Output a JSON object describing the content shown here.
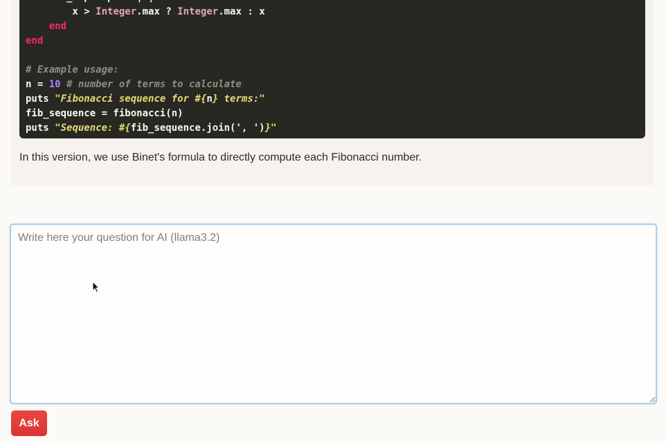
{
  "answer": {
    "code_lines": [
      [
        {
          "t": "    ",
          "c": "plain"
        },
        {
          "t": "fib_map",
          "c": "plain"
        },
        {
          "t": ".",
          "c": "plain"
        },
        {
          "t": "map",
          "c": "plain"
        },
        {
          "t": " do ",
          "c": "kw"
        },
        {
          "t": "|x|",
          "c": "plain"
        }
      ],
      [
        {
          "t": "        x > ",
          "c": "plain"
        },
        {
          "t": "Integer",
          "c": "cls"
        },
        {
          "t": ".max ? ",
          "c": "plain"
        },
        {
          "t": "Integer",
          "c": "cls"
        },
        {
          "t": ".max : x",
          "c": "plain"
        }
      ],
      [
        {
          "t": "    ",
          "c": "plain"
        },
        {
          "t": "end",
          "c": "kw"
        }
      ],
      [
        {
          "t": "end",
          "c": "kw"
        }
      ],
      [
        {
          "t": "",
          "c": "plain"
        }
      ],
      [
        {
          "t": "# Example usage:",
          "c": "cmt"
        }
      ],
      [
        {
          "t": "n = ",
          "c": "plain"
        },
        {
          "t": "10",
          "c": "num"
        },
        {
          "t": " ",
          "c": "plain"
        },
        {
          "t": "# number of terms to calculate",
          "c": "cmt"
        }
      ],
      [
        {
          "t": "puts ",
          "c": "plain"
        },
        {
          "t": "\"Fibonacci sequence for #{",
          "c": "str"
        },
        {
          "t": "n",
          "c": "plain"
        },
        {
          "t": "} terms:\"",
          "c": "str"
        }
      ],
      [
        {
          "t": "fib_sequence = fibonacci(n)",
          "c": "plain"
        }
      ],
      [
        {
          "t": "puts ",
          "c": "plain"
        },
        {
          "t": "\"Sequence: #{",
          "c": "str"
        },
        {
          "t": "fib_sequence.join(', ')",
          "c": "plain"
        },
        {
          "t": "}\"",
          "c": "str"
        }
      ]
    ],
    "text": "In this version, we use Binet's formula to directly compute each Fibonacci number."
  },
  "question": {
    "placeholder": "Write here your question for AI (llama3.2)",
    "value": ""
  },
  "ask_button": {
    "label": "Ask",
    "color": "#e0403b"
  }
}
